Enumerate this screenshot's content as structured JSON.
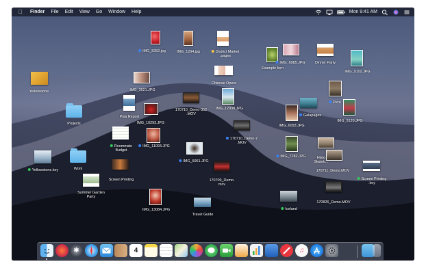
{
  "menubar": {
    "app": "Finder",
    "items": [
      "File",
      "Edit",
      "View",
      "Go",
      "Window",
      "Help"
    ],
    "clock": "Mon 9:41 AM",
    "status_icons": [
      "wifi-icon",
      "airplay-icon",
      "battery-icon",
      "search-icon",
      "siri-icon",
      "menu-icon"
    ]
  },
  "tag_colors": {
    "blue": "#3b82f6",
    "yellow": "#f5c542",
    "green": "#34c759"
  },
  "desktop": {
    "img_8352": "IMG_8352.jpg",
    "img_1294": "IMG_1294.jpg",
    "district_market": [
      "District Market",
      ".pages"
    ],
    "img_6985": "IMG_6985.JPG",
    "dinner_party": "Dinner Party",
    "example_fern": "Example fern",
    "img_9102": "IMG_9102.JPG",
    "yellowstone": "Yellowstone",
    "img_3921": "IMG_3921.JPG",
    "chinese_opera": "Chinese Opera",
    "peru": "Peru",
    "projects": "Projects",
    "pisa_report": "Pisa Report",
    "img_10293": "IMG_10293.JPG",
    "demo_352": [
      "170710_Demo-352",
      ".MOV"
    ],
    "img_12938": "IMG_12938.JPG",
    "galapagos": "Galapagos",
    "img_6093": "IMG_6093.JPG",
    "img_9120": "IMG_9120.JPG",
    "roommate_budget": [
      "Roommate",
      "Budget"
    ],
    "img_11093": "IMG_11093.JPG",
    "demo_7": [
      "170710_Demo-7",
      ".MOV"
    ],
    "img_7282": "IMG_7282.JPG",
    "histo_skateb": [
      "Histo",
      "Skateb..."
    ],
    "yellowstone_key": "Yellowstone.key",
    "work": "Work",
    "screen_printing": "Screen Printing",
    "img_5961": "IMG_5961.JPG",
    "demo_709": [
      "170709_Demo.",
      "mov"
    ],
    "demo_711": "170711_Demo.MOV",
    "screen_printing_key": [
      "Screen Printing",
      ".key"
    ],
    "summer_garden": [
      "Summer Garden",
      "Party"
    ],
    "img_13084": "IMG_13084.JPG",
    "travel_guide": "Travel Guide",
    "iceland": "Iceland",
    "demo_826": "170826_Demo.MOV"
  },
  "dock": {
    "apps": [
      "finder-icon",
      "launchpad-icon",
      "siri-icon",
      "safari-icon",
      "mail-icon",
      "contacts-icon",
      "calendar-icon",
      "notes-icon",
      "reminders-icon",
      "maps-icon",
      "photos-icon",
      "messages-icon",
      "facetime-icon",
      "pages-icon",
      "numbers-icon",
      "keynote-icon",
      "news-icon",
      "music-icon",
      "app-store-icon",
      "system-preferences-icon",
      "downloads-icon",
      "trash-icon"
    ],
    "calendar_day": "4"
  }
}
